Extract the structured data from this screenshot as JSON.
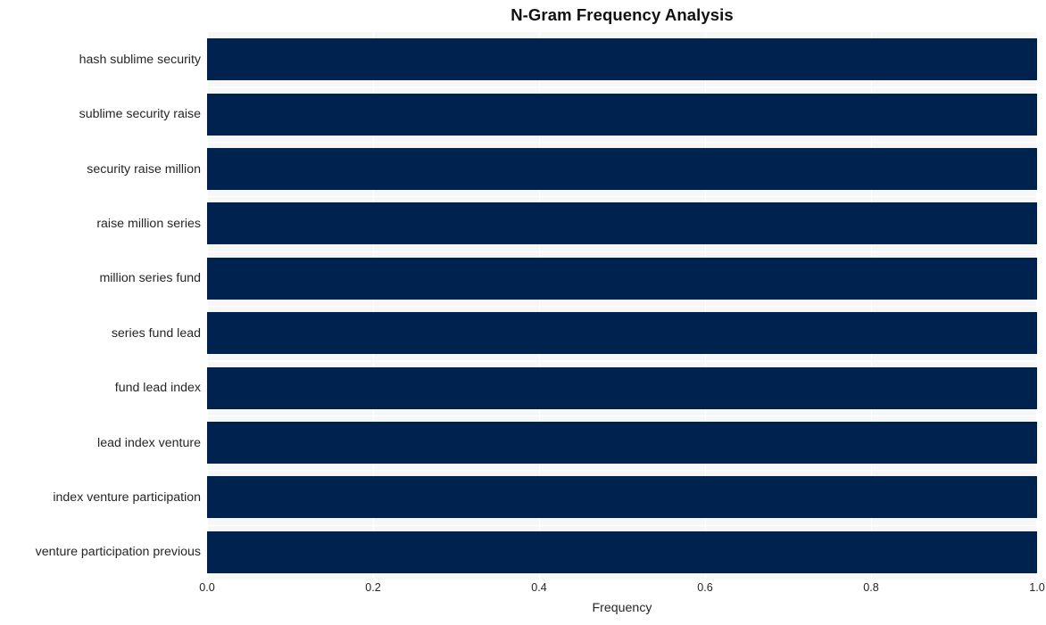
{
  "chart_data": {
    "type": "bar",
    "orientation": "horizontal",
    "title": "N-Gram Frequency Analysis",
    "xlabel": "Frequency",
    "ylabel": "",
    "xlim": [
      0.0,
      1.0
    ],
    "xticks": [
      "0.0",
      "0.2",
      "0.4",
      "0.6",
      "0.8",
      "1.0"
    ],
    "xtick_values": [
      0.0,
      0.2,
      0.4,
      0.6,
      0.8,
      1.0
    ],
    "grid": true,
    "legend": "none",
    "bar_color": "#00224e",
    "plot_background": "#f7f7f7",
    "figure_background": "#ffffff",
    "gridline_color": "#ffffff",
    "text_color": "#262626",
    "categories": [
      "hash sublime security",
      "sublime security raise",
      "security raise million",
      "raise million series",
      "million series fund",
      "series fund lead",
      "fund lead index",
      "lead index venture",
      "index venture participation",
      "venture participation previous"
    ],
    "values": [
      1.0,
      1.0,
      1.0,
      1.0,
      1.0,
      1.0,
      1.0,
      1.0,
      1.0,
      1.0
    ]
  }
}
